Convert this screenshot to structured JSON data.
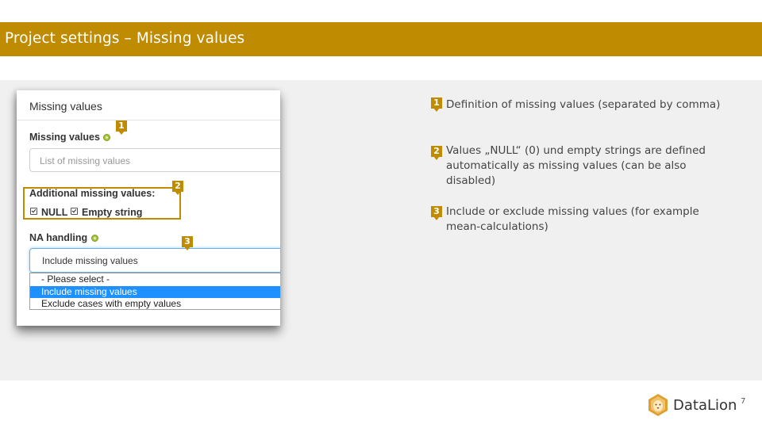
{
  "slide": {
    "title": "Project settings – Missing values",
    "page_number": "7"
  },
  "panel": {
    "header": "Missing values",
    "missing_values_label": "Missing values",
    "missing_values_placeholder": "List of missing values",
    "additional_label": "Additional missing values:",
    "checkbox_null": {
      "label": "NULL",
      "checked": true
    },
    "checkbox_empty": {
      "label": "Empty string",
      "checked": true
    },
    "na_label": "NA handling",
    "select_value": "Include missing values",
    "options": [
      "- Please select -",
      "Include missing values",
      "Exclude cases with empty values"
    ],
    "selected_option": "Include missing values"
  },
  "markers": [
    "1",
    "2",
    "3"
  ],
  "bullets": [
    {
      "num": "1",
      "text": "Definition of missing values (separated by comma)"
    },
    {
      "num": "2",
      "text": "Values „NULL“ (0) und empty strings are defined automatically as missing values (can be also disabled)"
    },
    {
      "num": "3",
      "text": "Include or exclude missing values (for example mean-calculations)"
    }
  ],
  "logo": {
    "text": "DataLion"
  },
  "colors": {
    "accent": "#bf8b00",
    "select_highlight": "#1e90ff",
    "help_icon": "#a8c43a"
  }
}
